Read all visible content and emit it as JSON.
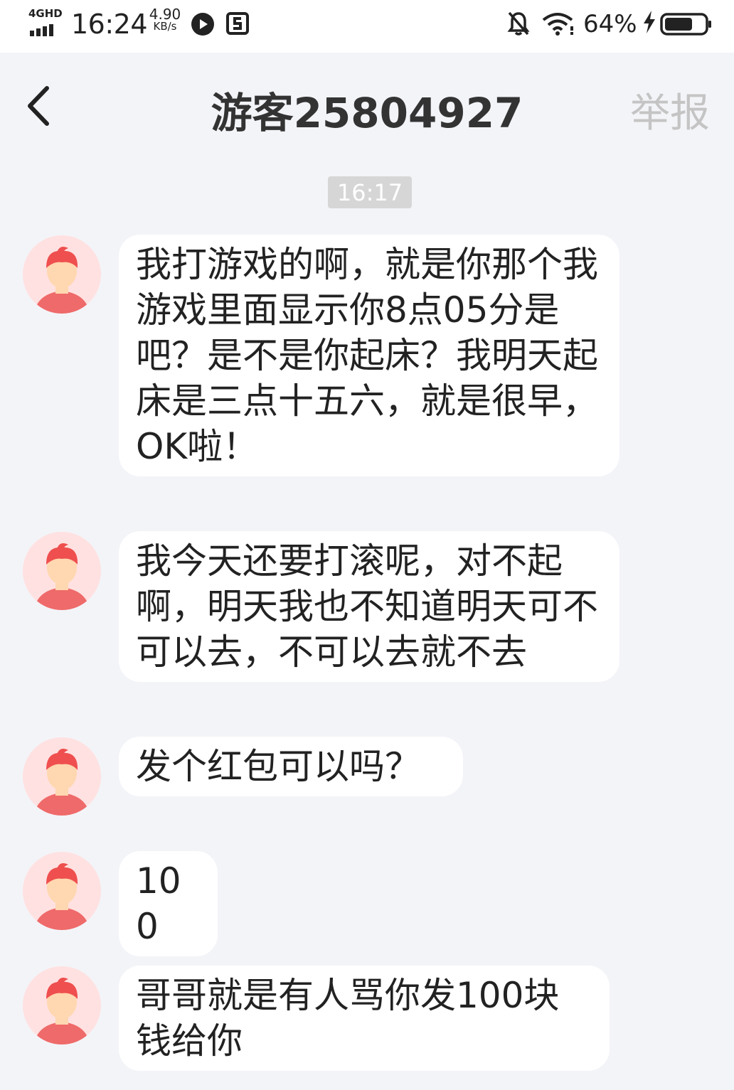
{
  "status_bar": {
    "network": "4GHD",
    "time": "16:24",
    "speed_value": "4.90",
    "speed_unit": "KB/s",
    "battery_percent": "64%",
    "icons": [
      "signal-icon",
      "app-notification-icon",
      "app-s-icon",
      "mute-bell-icon",
      "wifi-icon",
      "charging-icon",
      "battery-icon"
    ]
  },
  "header": {
    "title": "游客25804927",
    "report_label": "举报",
    "back_icon": "chevron-left-icon"
  },
  "chat": {
    "timestamp": "16:17",
    "messages": [
      {
        "sender": "other",
        "text": "我打游戏的啊，就是你那个我游戏里面显示你8点05分是吧？是不是你起床？我明天起床是三点十五六，就是很早，OK啦！"
      },
      {
        "sender": "other",
        "text": "我今天还要打滚呢，对不起啊，明天我也不知道明天可不可以去，不可以去就不去"
      },
      {
        "sender": "other",
        "text": "发个红包可以吗？"
      },
      {
        "sender": "other",
        "text": "100"
      },
      {
        "sender": "other",
        "text": "哥哥就是有人骂你发100块钱给你"
      }
    ]
  },
  "colors": {
    "background": "#f3f4f8",
    "bubble": "#ffffff",
    "avatar_bg": "#ffe1e1",
    "avatar_figure": "#ef6a6a",
    "report_text": "#c4c4c4",
    "timestamp_bg": "#d6d6d6"
  }
}
